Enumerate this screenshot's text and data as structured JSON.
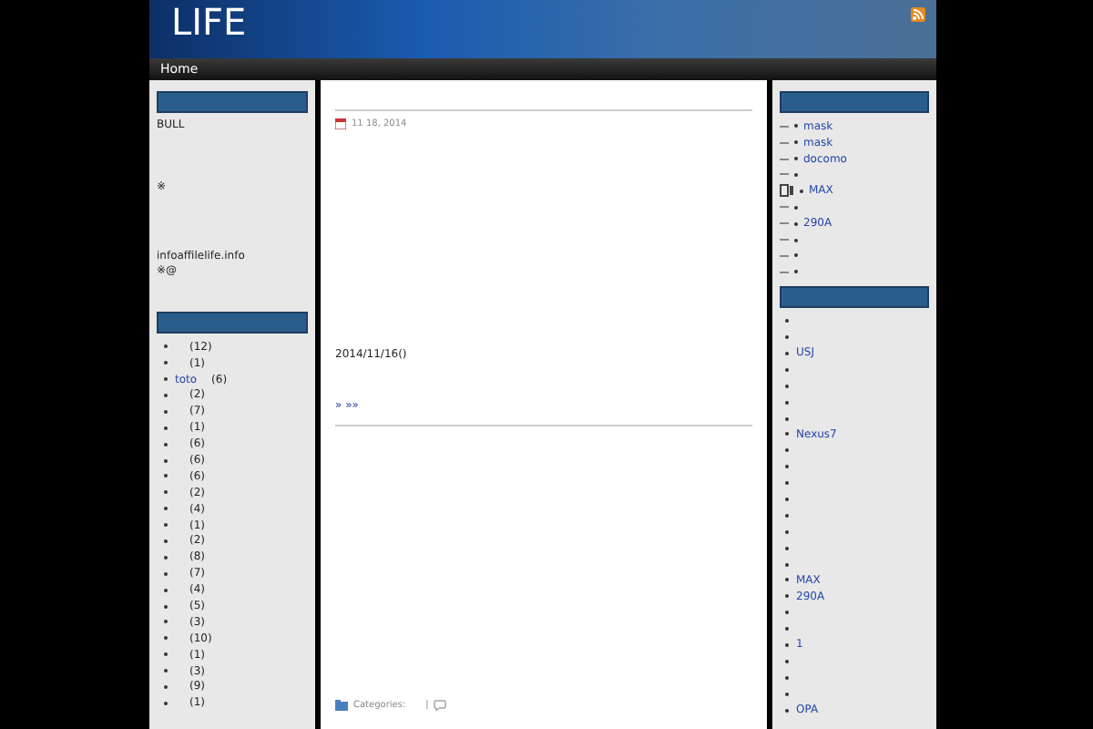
{
  "header": {
    "title": "LIFE"
  },
  "nav": [
    {
      "label": "Home",
      "selected": true
    }
  ],
  "left_sidebar": {
    "text_widget": {
      "lines": [
        "BULL",
        "※",
        "infoaffilelife.info",
        "※@"
      ]
    },
    "categories": [
      {
        "count": "(12)"
      },
      {
        "count": "(1)"
      },
      {
        "label": "toto",
        "count": "(6)"
      },
      {
        "count": "(2)"
      },
      {
        "count": "(7)"
      },
      {
        "count": "(1)"
      },
      {
        "count": "(6)"
      },
      {
        "count": "(6)"
      },
      {
        "count": "(6)"
      },
      {
        "count": "(2)"
      },
      {
        "count": "(4)"
      },
      {
        "count": "(1)"
      },
      {
        "count": "(2)"
      },
      {
        "count": "(8)"
      },
      {
        "count": "(7)"
      },
      {
        "count": "(4)"
      },
      {
        "count": "(5)"
      },
      {
        "count": "(3)"
      },
      {
        "count": "(10)"
      },
      {
        "count": "(1)"
      },
      {
        "count": "(3)"
      },
      {
        "count": "(9)"
      },
      {
        "count": "(1)"
      }
    ]
  },
  "post": {
    "date": "11 18, 2014",
    "body": "2014/11/16()",
    "more_link": "» »»",
    "meta": {
      "categories_label": "Categories:",
      "separator": "|"
    }
  },
  "right_sidebar": {
    "recent": [
      {
        "kind": "link",
        "label": "mask"
      },
      {
        "kind": "link",
        "label": "mask"
      },
      {
        "kind": "link",
        "label": "docomo"
      },
      {
        "kind": "bullet"
      },
      {
        "kind": "icon_link",
        "label": "MAX"
      },
      {
        "kind": "bullet"
      },
      {
        "kind": "link",
        "label": "290A"
      },
      {
        "kind": "bullet"
      },
      {
        "kind": "bullet"
      },
      {
        "kind": "bullet"
      }
    ],
    "tags": [
      {
        "kind": "bullet"
      },
      {
        "kind": "bullet"
      },
      {
        "kind": "link",
        "label": "USJ"
      },
      {
        "kind": "bullet"
      },
      {
        "kind": "bullet"
      },
      {
        "kind": "bullet"
      },
      {
        "kind": "bullet"
      },
      {
        "kind": "link",
        "label": "Nexus7"
      },
      {
        "kind": "bullet"
      },
      {
        "kind": "bullet"
      },
      {
        "kind": "bullet"
      },
      {
        "kind": "bullet"
      },
      {
        "kind": "bullet"
      },
      {
        "kind": "bullet"
      },
      {
        "kind": "bullet"
      },
      {
        "kind": "bullet"
      },
      {
        "kind": "link",
        "label": "MAX"
      },
      {
        "kind": "link",
        "label": "290A"
      },
      {
        "kind": "bullet"
      },
      {
        "kind": "bullet"
      },
      {
        "kind": "link",
        "label": "1"
      },
      {
        "kind": "bullet"
      },
      {
        "kind": "bullet"
      },
      {
        "kind": "bullet"
      },
      {
        "kind": "link",
        "label": "OPA"
      }
    ]
  }
}
